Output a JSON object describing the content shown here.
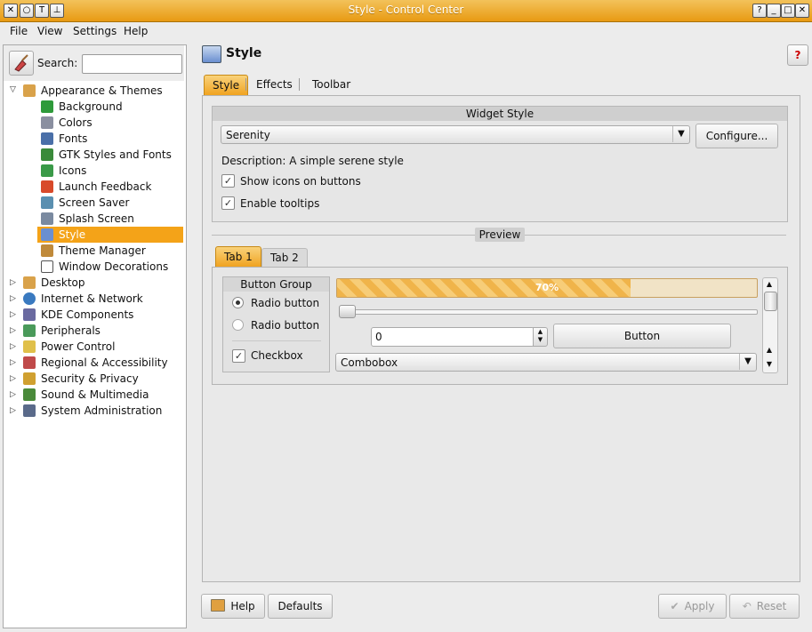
{
  "window": {
    "title": "Style - Control Center"
  },
  "menu": {
    "file": "File",
    "view": "View",
    "settings": "Settings",
    "help": "Help"
  },
  "search": {
    "label": "Search:",
    "value": ""
  },
  "tree": {
    "root": "Appearance & Themes",
    "children": [
      "Background",
      "Colors",
      "Fonts",
      "GTK Styles and Fonts",
      "Icons",
      "Launch Feedback",
      "Screen Saver",
      "Splash Screen",
      "Style",
      "Theme Manager",
      "Window Decorations"
    ],
    "groups": [
      "Desktop",
      "Internet & Network",
      "KDE Components",
      "Peripherals",
      "Power Control",
      "Regional & Accessibility",
      "Security & Privacy",
      "Sound & Multimedia",
      "System Administration"
    ],
    "selected": "Style"
  },
  "header": {
    "title": "Style"
  },
  "tabs": [
    "Style",
    "Effects",
    "Toolbar"
  ],
  "widget_style": {
    "title": "Widget Style",
    "combo_value": "Serenity",
    "configure": "Configure...",
    "description": "Description: A simple serene style",
    "show_icons": "Show icons on buttons",
    "enable_tooltips": "Enable tooltips"
  },
  "preview": {
    "label": "Preview",
    "tabs": [
      "Tab 1",
      "Tab 2"
    ],
    "button_group": "Button Group",
    "radio1": "Radio button",
    "radio2": "Radio button",
    "checkbox": "Checkbox",
    "progress": 0.7,
    "progress_text": "70%",
    "spin_value": "0",
    "button": "Button",
    "combobox": "Combobox"
  },
  "footer": {
    "help": "Help",
    "defaults": "Defaults",
    "apply": "Apply",
    "reset": "Reset"
  },
  "colors": {
    "accent": "#f4a318",
    "titlebar": "#e89a12"
  }
}
